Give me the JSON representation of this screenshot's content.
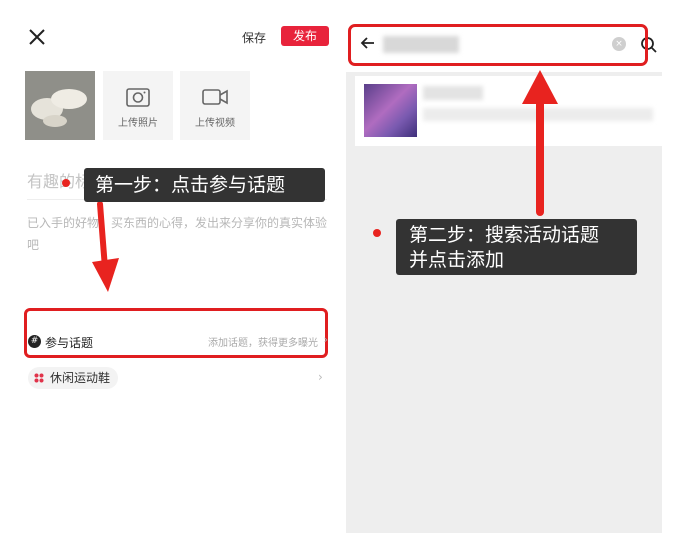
{
  "editor": {
    "save_label": "保存",
    "publish_label": "发布",
    "upload_photo_label": "上传照片",
    "upload_video_label": "上传视频",
    "title_placeholder": "有趣的标",
    "body_placeholder": "已入手的好物、买东西的心得，发出来分享你的真实体验吧",
    "topic_label": "参与话题",
    "topic_hint": "添加话题，获得更多曝光",
    "tag_label": "休闲运动鞋"
  },
  "annotations": {
    "step1": "第一步：点击参与话题",
    "step2_line1": "第二步：搜索活动话题",
    "step2_line2": "并点击添加",
    "highlight_color": "#e01e20",
    "callout_bg": "#333333"
  },
  "search": {
    "placeholder": ""
  },
  "colors": {
    "publish": "#e8233b",
    "right_bg": "#eeeeee"
  }
}
